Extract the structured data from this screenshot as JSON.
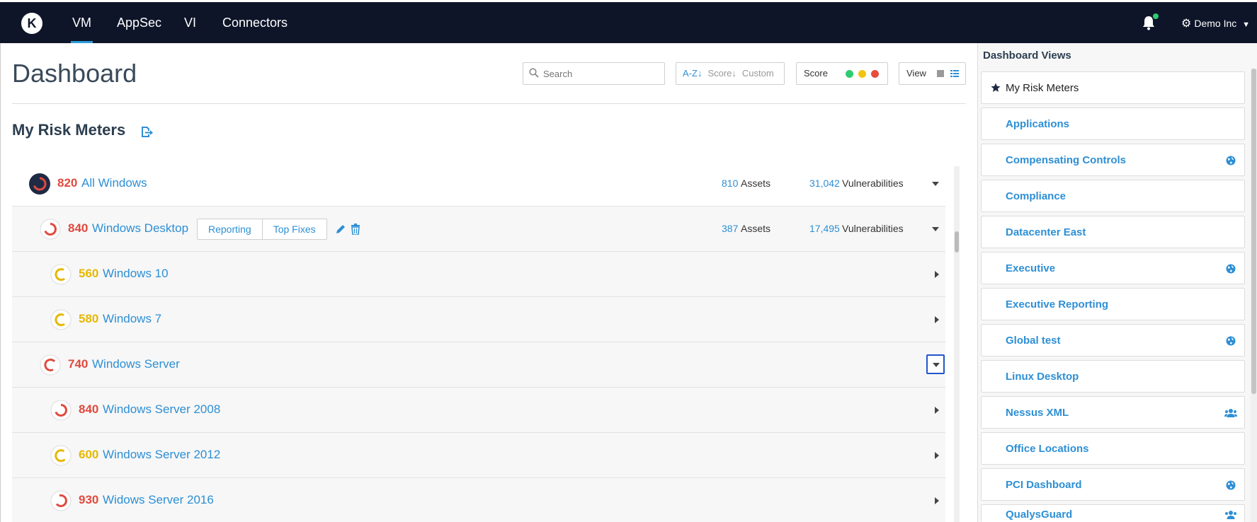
{
  "nav": {
    "logo_letter": "K",
    "items": [
      "VM",
      "AppSec",
      "VI",
      "Connectors"
    ],
    "active": "VM",
    "account": "Demo Inc"
  },
  "header": {
    "title": "Dashboard",
    "search_placeholder": "Search",
    "sort": {
      "az": "A-Z",
      "score": "Score",
      "custom": "Custom"
    },
    "score_filter_label": "Score",
    "score_colors": [
      "#2ecc71",
      "#f1c40f",
      "#e74c3c"
    ],
    "view_label": "View"
  },
  "section": {
    "title": "My Risk Meters"
  },
  "risk_meters": [
    {
      "score": "820",
      "name": "All Windows",
      "level": "red",
      "assets": "810",
      "assets_label": "Assets",
      "vulns": "31,042",
      "vulns_label": "Vulnerabilities"
    },
    {
      "score": "840",
      "name": "Windows Desktop",
      "level": "red",
      "assets": "387",
      "assets_label": "Assets",
      "vulns": "17,495",
      "vulns_label": "Vulnerabilities",
      "buttons": [
        "Reporting",
        "Top Fixes"
      ]
    },
    {
      "score": "560",
      "name": "Windows 10",
      "level": "yellow"
    },
    {
      "score": "580",
      "name": "Windows 7",
      "level": "yellow"
    },
    {
      "score": "740",
      "name": "Windows Server",
      "level": "red"
    },
    {
      "score": "840",
      "name": "Windows Server 2008",
      "level": "red"
    },
    {
      "score": "600",
      "name": "Windows Server 2012",
      "level": "yellow"
    },
    {
      "score": "930",
      "name": "Widows Server 2016",
      "level": "red"
    }
  ],
  "dashboard_views": {
    "title": "Dashboard Views",
    "items": [
      {
        "label": "My Risk Meters",
        "icon": "star-icon"
      },
      {
        "label": "Applications",
        "icon": ""
      },
      {
        "label": "Compensating Controls",
        "icon": "globe-icon"
      },
      {
        "label": "Compliance",
        "icon": ""
      },
      {
        "label": "Datacenter East",
        "icon": ""
      },
      {
        "label": "Executive",
        "icon": "globe-icon"
      },
      {
        "label": "Executive Reporting",
        "icon": ""
      },
      {
        "label": "Global test",
        "icon": "globe-icon"
      },
      {
        "label": "Linux Desktop",
        "icon": ""
      },
      {
        "label": "Nessus XML",
        "icon": "users-icon"
      },
      {
        "label": "Office Locations",
        "icon": ""
      },
      {
        "label": "PCI Dashboard",
        "icon": "globe-icon"
      },
      {
        "label": "QualysGuard",
        "icon": "users-icon"
      }
    ]
  },
  "colors": {
    "nav_bg": "#0e1529",
    "accent": "#2d8fd5",
    "red": "#e04a3f",
    "yellow": "#e6b800"
  }
}
